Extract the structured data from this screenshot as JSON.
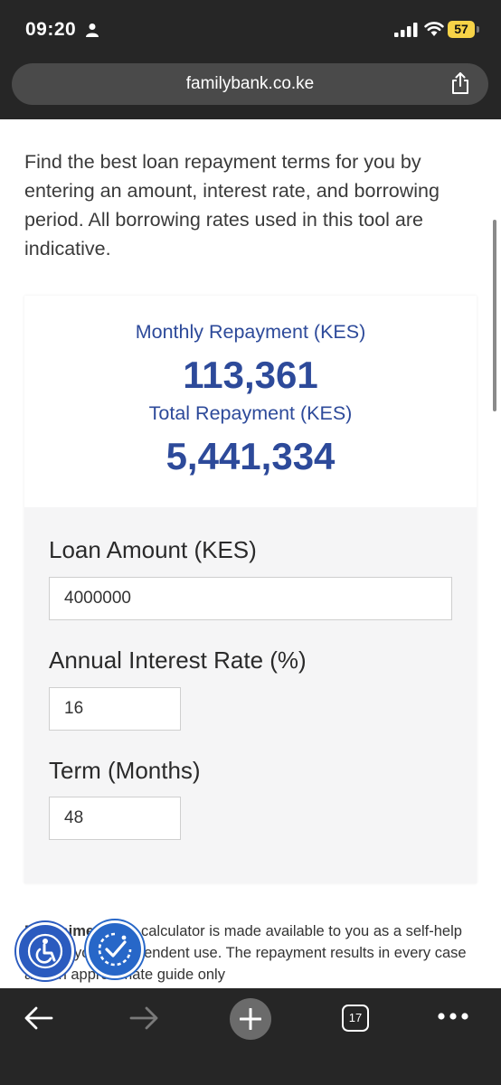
{
  "status_bar": {
    "time": "09:20",
    "battery": "57"
  },
  "browser": {
    "url": "familybank.co.ke",
    "tab_count": "17"
  },
  "page": {
    "intro": "Find the best loan repayment terms for you by entering an amount, interest rate, and borrowing period. All borrowing rates used in this tool are indicative.",
    "results": {
      "monthly_label": "Monthly Repayment (KES)",
      "monthly_value": "113,361",
      "total_label": "Total Repayment (KES)",
      "total_value": "5,441,334"
    },
    "form": {
      "loan_amount_label": "Loan Amount (KES)",
      "loan_amount_value": "4000000",
      "interest_label": "Annual Interest Rate (%)",
      "interest_value": "16",
      "term_label": "Term (Months)",
      "term_value": "48"
    },
    "disclaimer": {
      "bold": "Disclaimer:",
      "text": " This calculator is made available to you as a self-help tool for your independent use. The repayment results in every case are an approximate guide only"
    }
  },
  "colors": {
    "accent": "#2d4a9a",
    "chrome": "#262626",
    "battery": "#f7d347"
  },
  "icons": [
    "person-icon",
    "signal-icon",
    "wifi-icon",
    "share-icon",
    "accessibility-icon",
    "accessibility-check-icon",
    "back-arrow-icon",
    "forward-arrow-icon",
    "plus-icon",
    "more-icon"
  ]
}
